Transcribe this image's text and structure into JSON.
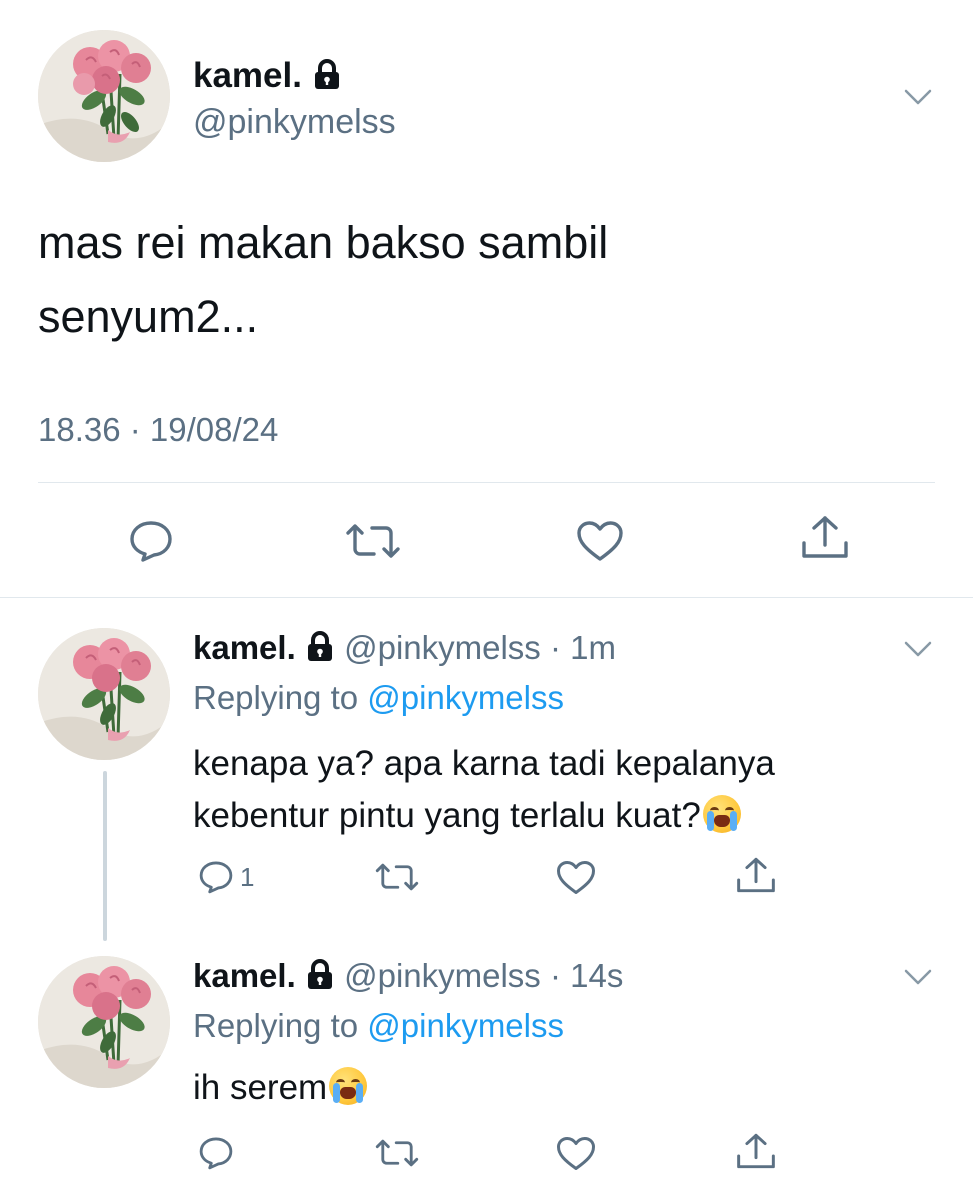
{
  "main_tweet": {
    "display_name": "kamel.",
    "handle": "@pinkymelss",
    "text_line1": "mas rei makan bakso sambil",
    "text_line2": "senyum2...",
    "timestamp": "18.36 · 19/08/24"
  },
  "replies": [
    {
      "display_name": "kamel.",
      "handle": "@pinkymelss",
      "time": "1m",
      "replying_prefix": "Replying to",
      "replying_handle": "@pinkymelss",
      "text_line1": "kenapa ya? apa karna tadi kepalanya",
      "text_line2": "kebentur pintu yang terlalu kuat?",
      "reply_count": "1"
    },
    {
      "display_name": "kamel.",
      "handle": "@pinkymelss",
      "time": "14s",
      "replying_prefix": "Replying to",
      "replying_handle": "@pinkymelss",
      "text_line1": "ih serem"
    }
  ],
  "icons": {
    "reply": "reply-bubble-icon",
    "retweet": "retweet-icon",
    "like": "heart-icon",
    "share": "share-icon",
    "protected": "lock-icon",
    "more": "chevron-down-icon",
    "emoji": "loudly-crying-face-emoji"
  },
  "colors": {
    "text": "#0f1419",
    "muted": "#5b7083",
    "link": "#1d9bf0",
    "divider": "#e1e8ed",
    "thread_line": "#ccd6dd"
  }
}
